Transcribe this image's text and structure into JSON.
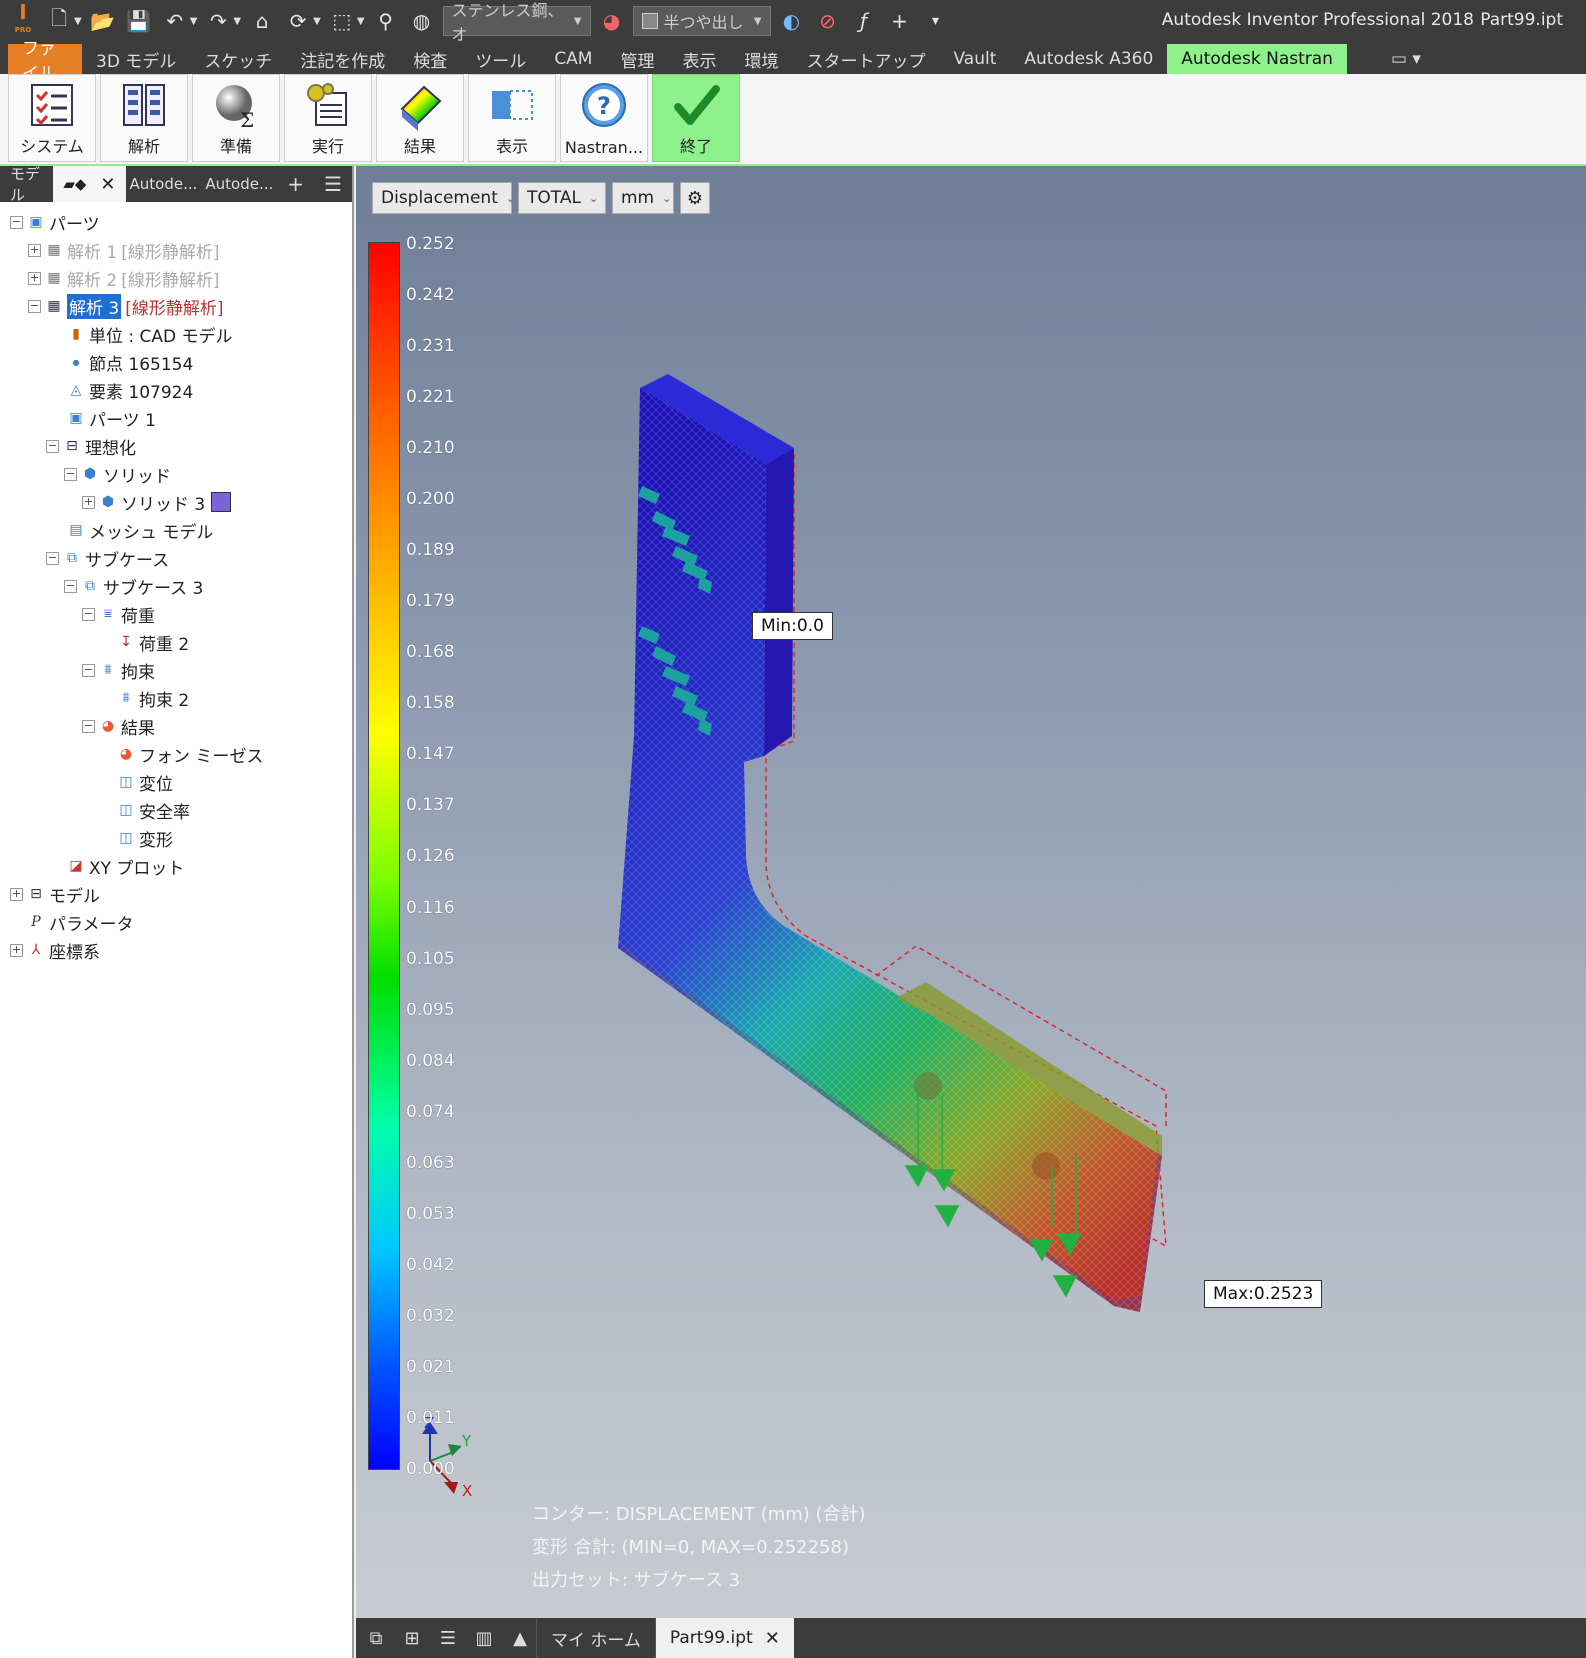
{
  "titlebar": {
    "material": "ステンレス鋼、オ",
    "appearance": "半つや出し",
    "title": "Autodesk Inventor Professional 2018",
    "file": "Part99.ipt",
    "pro_label": "PRO"
  },
  "menu": {
    "tabs": [
      "ファイル",
      "3D モデル",
      "スケッチ",
      "注記を作成",
      "検査",
      "ツール",
      "CAM",
      "管理",
      "表示",
      "環境",
      "スタートアップ",
      "Vault",
      "Autodesk A360",
      "Autodesk Nastran"
    ]
  },
  "ribbon": {
    "buttons": [
      "システム",
      "解析",
      "準備",
      "実行",
      "結果",
      "表示",
      "Nastran...",
      "終了"
    ]
  },
  "browser": {
    "tabs": [
      "モデル",
      "Autode...",
      "Autode..."
    ],
    "tree": [
      {
        "label": "パーツ"
      },
      {
        "label": "解析 1",
        "suffix": "[線形静解析]"
      },
      {
        "label": "解析 2",
        "suffix": "[線形静解析]"
      },
      {
        "label": "解析 3",
        "suffix": "[線形静解析]"
      },
      {
        "label": "単位 : CAD モデル"
      },
      {
        "label": "節点 165154"
      },
      {
        "label": "要素 107924"
      },
      {
        "label": "パーツ 1"
      },
      {
        "label": "理想化"
      },
      {
        "label": "ソリッド"
      },
      {
        "label": "ソリッド 3"
      },
      {
        "label": "メッシュ モデル"
      },
      {
        "label": "サブケース"
      },
      {
        "label": "サブケース 3"
      },
      {
        "label": "荷重"
      },
      {
        "label": "荷重 2"
      },
      {
        "label": "拘束"
      },
      {
        "label": "拘束 2"
      },
      {
        "label": "結果"
      },
      {
        "label": "フォン ミーゼス"
      },
      {
        "label": "変位"
      },
      {
        "label": "安全率"
      },
      {
        "label": "変形"
      },
      {
        "label": "XY プロット"
      },
      {
        "label": "モデル"
      },
      {
        "label": "パラメータ"
      },
      {
        "label": "座標系"
      }
    ],
    "colors": {
      "selected": "#1e6fd4",
      "solid_swatch": "#7b63d9"
    }
  },
  "viewport": {
    "result_type": "Displacement",
    "component": "TOTAL",
    "unit": "mm",
    "scale_values": [
      "0.252",
      "0.242",
      "0.231",
      "0.221",
      "0.210",
      "0.200",
      "0.189",
      "0.179",
      "0.168",
      "0.158",
      "0.147",
      "0.137",
      "0.126",
      "0.116",
      "0.105",
      "0.095",
      "0.084",
      "0.074",
      "0.063",
      "0.053",
      "0.042",
      "0.032",
      "0.021",
      "0.011",
      "0.000"
    ],
    "min_label": "Min:0.0",
    "max_label": "Max:0.2523",
    "legend_lines": [
      "コンター: DISPLACEMENT (mm) (合計)",
      "変形 合計: (MIN=0, MAX=0.252258)",
      "出力セット: サブケース 3"
    ],
    "axis": {
      "x": "X",
      "y": "Y",
      "z": "Z"
    }
  },
  "bottom": {
    "tabs": [
      "マイ ホーム",
      "Part99.ipt"
    ]
  }
}
